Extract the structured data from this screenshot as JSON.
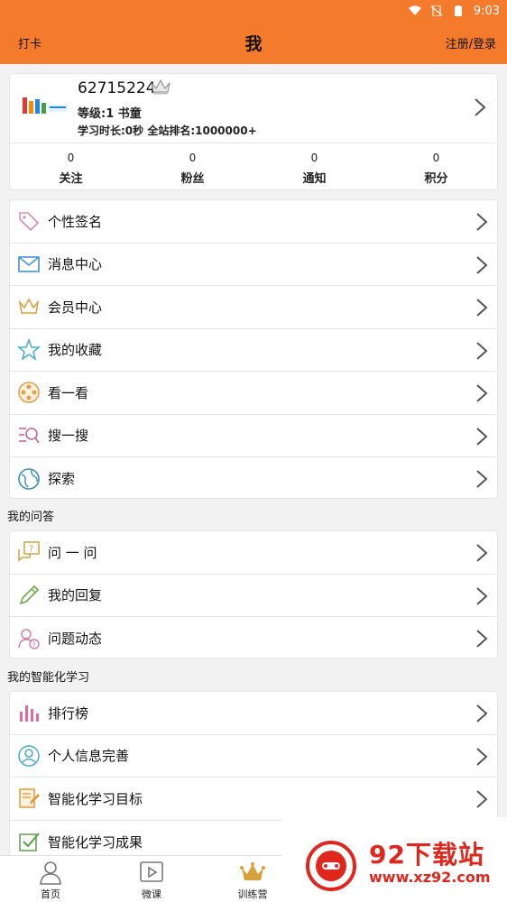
{
  "status_bar": {
    "time": "9:03"
  },
  "app_bar": {
    "left": "打卡",
    "title": "我",
    "right": "注册/登录"
  },
  "profile": {
    "user_id": "62715224",
    "level": "等级:1 书童",
    "study": "学习时长:0秒  全站排名:1000000+",
    "stats": [
      {
        "value": "0",
        "label": "关注"
      },
      {
        "value": "0",
        "label": "粉丝"
      },
      {
        "value": "0",
        "label": "通知"
      },
      {
        "value": "0",
        "label": "积分"
      }
    ]
  },
  "menu1": [
    {
      "label": "个性签名",
      "icon": "tag-icon"
    },
    {
      "label": "消息中心",
      "icon": "mail-icon"
    },
    {
      "label": "会员中心",
      "icon": "crown-icon"
    },
    {
      "label": "我的收藏",
      "icon": "star-icon"
    },
    {
      "label": "看一看",
      "icon": "film-reel-icon"
    },
    {
      "label": "搜一搜",
      "icon": "search-list-icon"
    },
    {
      "label": "探索",
      "icon": "globe-icon"
    }
  ],
  "section_qa": "我的问答",
  "menu2": [
    {
      "label": "问 一 问",
      "icon": "question-bubble-icon"
    },
    {
      "label": "我的回复",
      "icon": "pencil-icon"
    },
    {
      "label": "问题动态",
      "icon": "user-question-icon"
    }
  ],
  "section_learning": "我的智能化学习",
  "menu3": [
    {
      "label": "排行榜",
      "icon": "bar-chart-icon"
    },
    {
      "label": "个人信息完善",
      "icon": "user-circle-icon"
    },
    {
      "label": "智能化学习目标",
      "icon": "edit-note-icon"
    },
    {
      "label": "智能化学习成果",
      "icon": "check-box-icon"
    }
  ],
  "tabs": [
    {
      "label": "首页",
      "icon": "person-icon"
    },
    {
      "label": "微课",
      "icon": "play-icon"
    },
    {
      "label": "训练营",
      "icon": "crown-icon"
    }
  ],
  "watermark": {
    "name": "92下载站",
    "url": "www.xz92.com"
  },
  "colors": {
    "accent": "#f47a2c",
    "watermark_red": "#e0271e"
  }
}
